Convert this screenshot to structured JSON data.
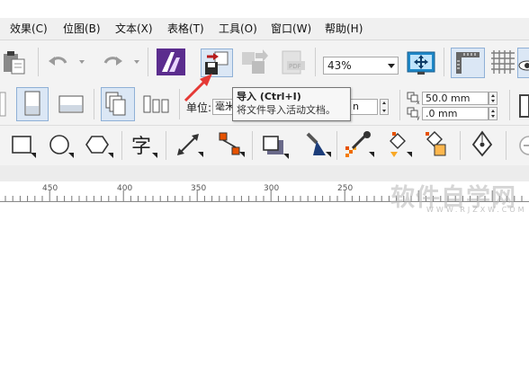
{
  "menu": {
    "items": [
      {
        "label": "效果(C)"
      },
      {
        "label": "位图(B)"
      },
      {
        "label": "文本(X)"
      },
      {
        "label": "表格(T)"
      },
      {
        "label": "工具(O)"
      },
      {
        "label": "窗口(W)"
      },
      {
        "label": "帮助(H)"
      }
    ]
  },
  "toolbar": {
    "zoom_value": "43%"
  },
  "tooltip": {
    "title": "导入 (Ctrl+I)",
    "description": "将文件导入活动文档。"
  },
  "property_bar": {
    "unit_label": "单位:",
    "unit_value": "毫米",
    "nudge_value": "n",
    "dup_x": "50.0 mm",
    "dup_y": ".0 mm"
  },
  "ruler": {
    "ticks": [
      "450",
      "400",
      "350",
      "300",
      "250"
    ]
  },
  "watermark": {
    "text": "软件自学网",
    "subtext": "WWW.RJZXW.COM"
  },
  "colors": {
    "accent_arrow": "#e53935",
    "toolbar_bg": "#f3f3f3",
    "menubar_bg": "#f0f0f0",
    "corel_logo": "#5b2d8e"
  },
  "icons": [
    "paste-icon",
    "undo-icon",
    "redo-icon",
    "corel-launcher-icon",
    "import-icon",
    "export-icon",
    "publish-pdf-icon",
    "full-screen-preview-icon",
    "rulers-icon",
    "grid-icon",
    "show-icon",
    "page-portrait-icon",
    "page-landscape-icon",
    "all-pages-icon",
    "current-page-icon",
    "rectangle-tool-icon",
    "ellipse-tool-icon",
    "polygon-tool-icon",
    "text-tool-icon",
    "dimension-tool-icon",
    "connector-tool-icon",
    "drop-shadow-tool-icon",
    "transparency-tool-icon",
    "color-eyedropper-icon",
    "interactive-fill-icon",
    "smart-fill-icon",
    "pen-outline-icon"
  ]
}
